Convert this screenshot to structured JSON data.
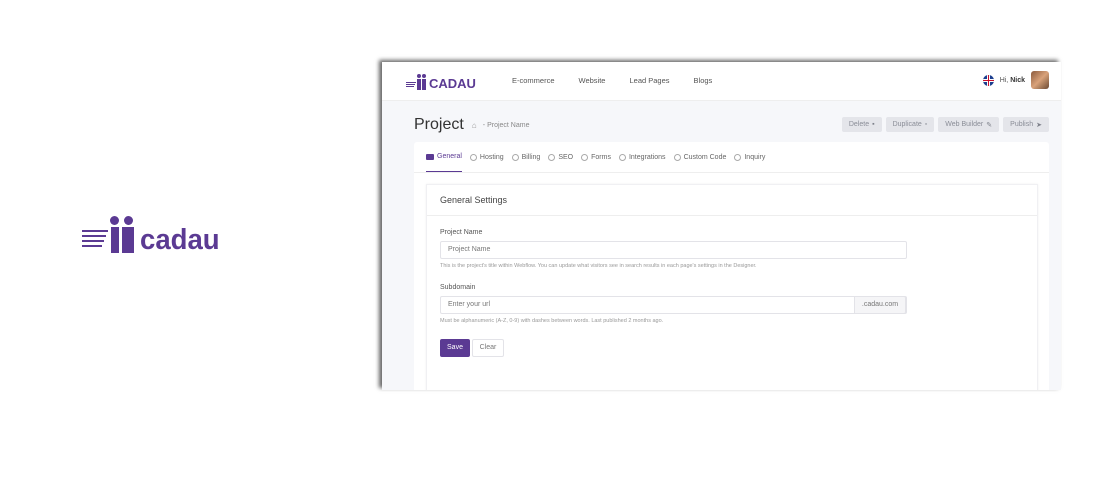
{
  "brand": {
    "logo_word_large": "cadau",
    "logo_word_small": "CADAU",
    "color": "#5b3a93"
  },
  "nav": {
    "items": [
      "E-commerce",
      "Website",
      "Lead Pages",
      "Blogs"
    ]
  },
  "user": {
    "greeting": "Hi,",
    "name": "Nick",
    "flag_icon": "uk-flag-icon"
  },
  "page": {
    "title": "Project",
    "breadcrumb": "- Project Name"
  },
  "actions": {
    "delete": "Delete",
    "duplicate": "Duplicate",
    "web_builder": "Web Builder",
    "publish": "Publish"
  },
  "tabs": [
    "General",
    "Hosting",
    "Billing",
    "SEO",
    "Forms",
    "Integrations",
    "Custom Code",
    "Inquiry"
  ],
  "settings": {
    "heading": "General Settings",
    "project_name_label": "Project Name",
    "project_name_placeholder": "Project Name",
    "project_name_help": "This is the project's title within Webflow. You can update what visitors see in search results in each page's settings in the Designer.",
    "subdomain_label": "Subdomain",
    "subdomain_placeholder": "Enter your url",
    "subdomain_suffix": ".cadau.com",
    "subdomain_help": "Must be alphanumeric (A-Z, 0-9) with dashes between words. Last published 2 months ago.",
    "save_label": "Save",
    "clear_label": "Clear"
  }
}
